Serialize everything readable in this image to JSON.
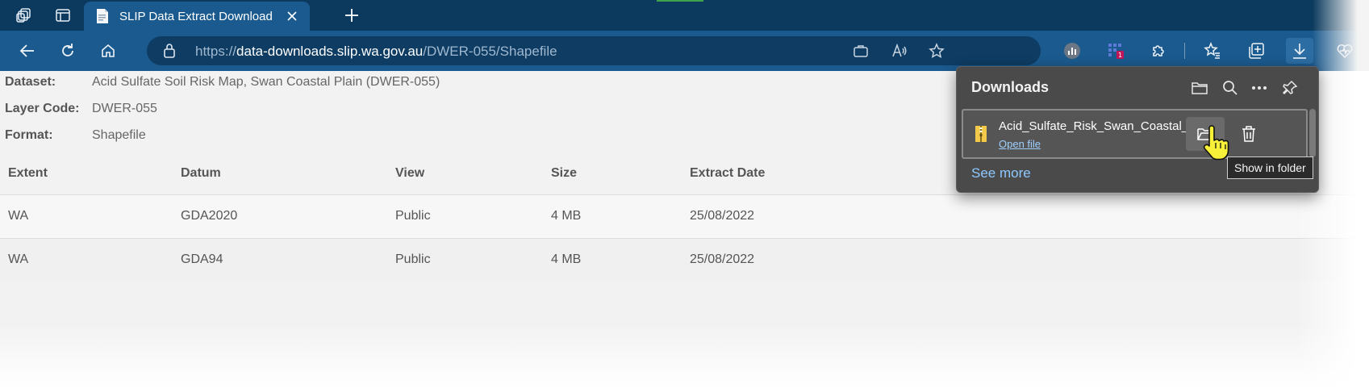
{
  "browser": {
    "tab": {
      "title": "SLIP Data Extract Download"
    },
    "address": {
      "scheme": "https://",
      "host": "data-downloads.slip.wa.gov.au",
      "path": "/DWER-055/Shapefile"
    }
  },
  "page": {
    "meta": [
      {
        "key": "Dataset:",
        "value": "Acid Sulfate Soil Risk Map, Swan Coastal Plain (DWER-055)"
      },
      {
        "key": "Layer Code:",
        "value": "DWER-055"
      },
      {
        "key": "Format:",
        "value": "Shapefile"
      }
    ],
    "table": {
      "headers": [
        "Extent",
        "Datum",
        "View",
        "Size",
        "Extract Date"
      ],
      "rows": [
        [
          "WA",
          "GDA2020",
          "Public",
          "4 MB",
          "25/08/2022"
        ],
        [
          "WA",
          "GDA94",
          "Public",
          "4 MB",
          "25/08/2022"
        ]
      ]
    }
  },
  "downloads": {
    "title": "Downloads",
    "item": {
      "filename": "Acid_Sulfate_Risk_Swan_Coastal_Plain_",
      "open_label": "Open file"
    },
    "see_more": "See more",
    "tooltip": "Show in folder"
  },
  "colors": {
    "tab_strip": "#0b3a5e",
    "toolbar": "#1b5a8e",
    "flyout": "#4a4a4a",
    "link": "#8ec8ff"
  }
}
